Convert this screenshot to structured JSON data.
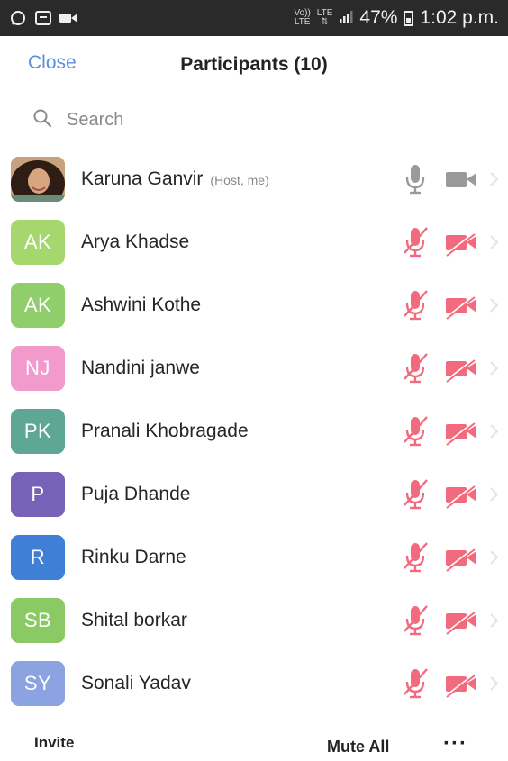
{
  "status_bar": {
    "network_type_1_top": "Vo))",
    "network_type_1_bottom": "LTE",
    "network_type_2": "LTE",
    "battery": "47%",
    "time": "1:02 p.m."
  },
  "header": {
    "close_label": "Close",
    "title": "Participants (10)"
  },
  "search": {
    "placeholder": "Search"
  },
  "participants": [
    {
      "name": "Karuna Ganvir",
      "tag": "(Host, me)",
      "initials": "",
      "avatar_color": "#b98a6b",
      "muted": false
    },
    {
      "name": "Arya Khadse",
      "tag": "",
      "initials": "AK",
      "avatar_color": "#a6d76f",
      "muted": true
    },
    {
      "name": "Ashwini Kothe",
      "tag": "",
      "initials": "AK",
      "avatar_color": "#8fce6a",
      "muted": true
    },
    {
      "name": "Nandini janwe",
      "tag": "",
      "initials": "NJ",
      "avatar_color": "#f29acb",
      "muted": true
    },
    {
      "name": "Pranali Khobragade",
      "tag": "",
      "initials": "PK",
      "avatar_color": "#5fa795",
      "muted": true
    },
    {
      "name": "Puja Dhande",
      "tag": "",
      "initials": "P",
      "avatar_color": "#7862b8",
      "muted": true
    },
    {
      "name": "Rinku Darne",
      "tag": "",
      "initials": "R",
      "avatar_color": "#3f7fd6",
      "muted": true
    },
    {
      "name": "Shital borkar",
      "tag": "",
      "initials": "SB",
      "avatar_color": "#8bc965",
      "muted": true
    },
    {
      "name": "Sonali Yadav",
      "tag": "",
      "initials": "SY",
      "avatar_color": "#8ba3e0",
      "muted": true
    }
  ],
  "footer": {
    "invite_label": "Invite",
    "mute_all_label": "Mute All",
    "more_label": "···"
  },
  "colors": {
    "accent": "#5a8fe0",
    "muted_red": "#f26a7e",
    "icon_gray": "#9a9a9a"
  }
}
